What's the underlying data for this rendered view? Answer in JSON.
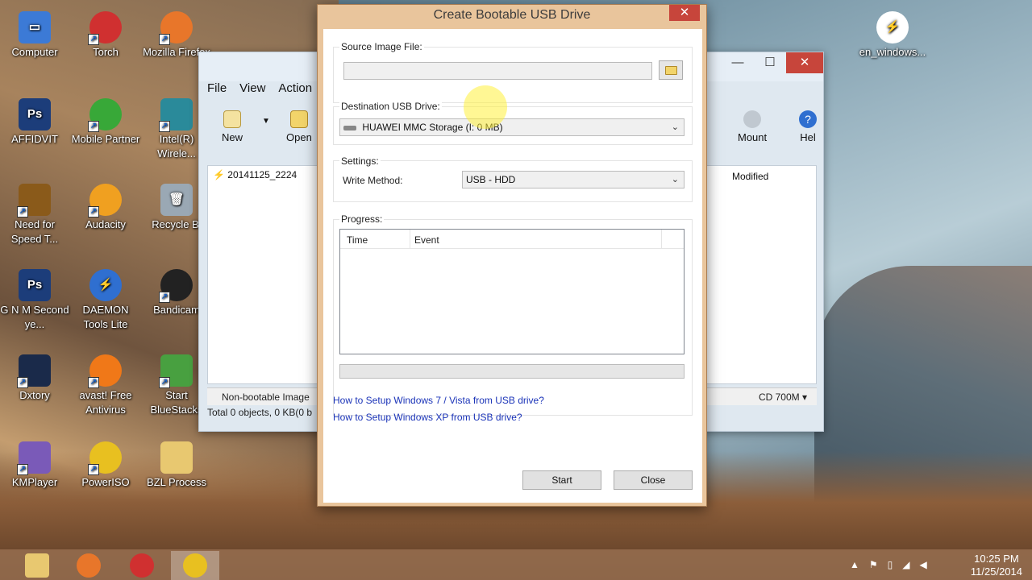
{
  "desktop": {
    "icons": [
      {
        "label": "Computer"
      },
      {
        "label": "Torch"
      },
      {
        "label": "Mozilla Firefox"
      },
      {
        "label": "AFFIDVIT"
      },
      {
        "label": "Mobile Partner"
      },
      {
        "label": "Intel(R) Wirele..."
      },
      {
        "label": "Need for Speed T..."
      },
      {
        "label": "Audacity"
      },
      {
        "label": "Recycle Bi"
      },
      {
        "label": "G N M Second ye..."
      },
      {
        "label": "DAEMON Tools Lite"
      },
      {
        "label": "Bandicam"
      },
      {
        "label": "Dxtory"
      },
      {
        "label": "avast! Free Antivirus"
      },
      {
        "label": "Start BlueStacks"
      },
      {
        "label": "KMPlayer"
      },
      {
        "label": "PowerISO"
      },
      {
        "label": "BZL Process"
      },
      {
        "label": "en_windows..."
      }
    ]
  },
  "explorer": {
    "menu": [
      "File",
      "View",
      "Action"
    ],
    "toolbar": {
      "new": "New",
      "open": "Open",
      "mount": "Mount",
      "help": "Hel"
    },
    "file_item": "20141125_2224",
    "col_modified": "Modified",
    "status_left": "Non-bootable Image",
    "status_right": "CD 700M",
    "status_total": "Total 0 objects, 0 KB(0 b"
  },
  "dialog": {
    "title": "Create Bootable USB Drive",
    "close_glyph": "✕",
    "source_label": "Source Image File:",
    "source_value": "",
    "dest_label": "Destination USB Drive:",
    "dest_value": "HUAWEI MMC Storage (I: 0 MB)",
    "settings_label": "Settings:",
    "write_method_label": "Write Method:",
    "write_method_value": "USB - HDD",
    "progress_label": "Progress:",
    "progress_fraction": 0,
    "col_time": "Time",
    "col_event": "Event",
    "link1": "How to Setup Windows 7 / Vista from USB drive?",
    "link2": "How to Setup Windows XP from USB drive?",
    "start_label": "Start",
    "close_label": "Close"
  },
  "taskbar": {
    "time": "10:25 PM",
    "date": "11/25/2014"
  }
}
